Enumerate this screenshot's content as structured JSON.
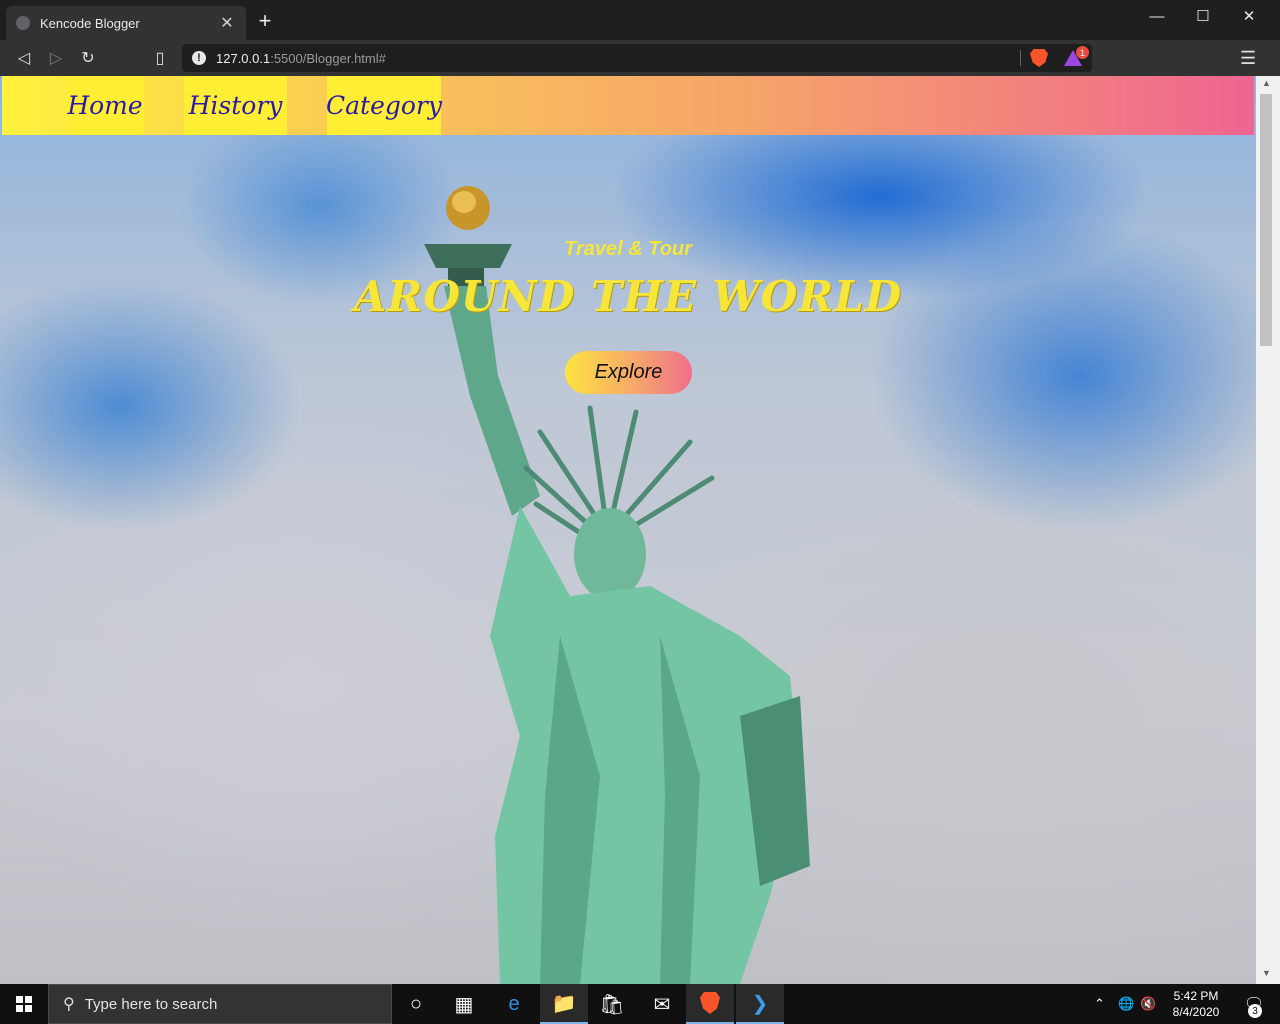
{
  "browser": {
    "tab_title": "Kencode Blogger",
    "new_tab": "+",
    "close_tab": "✕",
    "url_host": "127.0.0.1",
    "url_rest": ":5500/Blogger.html#",
    "rewards_badge": "1"
  },
  "page": {
    "nav": [
      {
        "label": "Home"
      },
      {
        "label": "History"
      },
      {
        "label": "Category"
      }
    ],
    "hero_subtitle": "Travel & Tour",
    "hero_title": "AROUND THE WORLD",
    "explore_label": "Explore"
  },
  "taskbar": {
    "search_placeholder": "Type here to search",
    "time": "5:42 PM",
    "date": "8/4/2020",
    "notification_count": "3"
  },
  "colors": {
    "nav_link": "#2a1aa8",
    "hero_text": "#f7e63a",
    "nav_item_bg": "#ffee34",
    "nav_gradient_start": "#fff23e",
    "nav_gradient_end": "#ee6592"
  }
}
